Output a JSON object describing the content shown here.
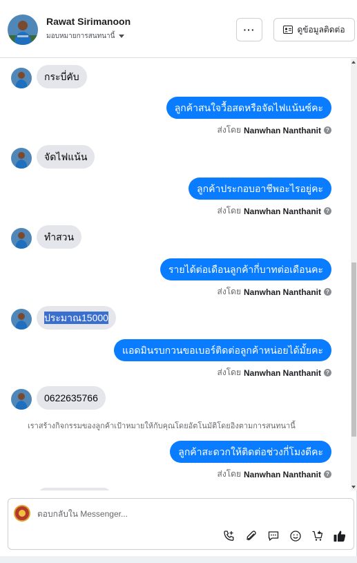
{
  "header": {
    "name": "Rawat Sirimanoon",
    "assign_label": "มอบหมายการสนทนานี้",
    "more_label": "···",
    "info_label": "ดูข้อมูลติดต่อ"
  },
  "messages": [
    {
      "type": "in",
      "text": "กระบี่คับ"
    },
    {
      "type": "out",
      "text": "ลูกค้าสนใจวื้อสดหรือจัดไฟแน้นซ์คะ",
      "sent_by_prefix": "ส่งโดย",
      "sent_by_name": "Nanwhan Nanthanit"
    },
    {
      "type": "in",
      "text": "จัดไฟแน้น"
    },
    {
      "type": "out",
      "text": "ลูกค้าประกอบอาชีพอะไรอยู่คะ",
      "sent_by_prefix": "ส่งโดย",
      "sent_by_name": "Nanwhan Nanthanit"
    },
    {
      "type": "in",
      "text": "ทำสวน"
    },
    {
      "type": "out",
      "text": "รายได้ต่อเดือนลูกค้ากี่บาทต่อเดือนคะ",
      "sent_by_prefix": "ส่งโดย",
      "sent_by_name": "Nanwhan Nanthanit"
    },
    {
      "type": "in",
      "text": "ประมาณ15000",
      "selected": true
    },
    {
      "type": "out",
      "text": "แอดมินรบกวนขอเบอร์ติดต่อลูกค้าหน่อยได้มั้ยคะ",
      "sent_by_prefix": "ส่งโดย",
      "sent_by_name": "Nanwhan Nanthanit"
    },
    {
      "type": "in",
      "text": "0622635766"
    },
    {
      "type": "note",
      "text": "เราสร้างกิจกรรมของลูกค้าเป้าหมายให้กับคุณโดยอัตโนมัติโดยอิงตามการสนทนานี้"
    },
    {
      "type": "out",
      "text": "ลูกค้าสะดวกให้ติดต่อช่วงกี่โมงดีคะ",
      "sent_by_prefix": "ส่งโดย",
      "sent_by_name": "Nanwhan Nanthanit"
    }
  ],
  "composer": {
    "placeholder": "ตอบกลับใน Messenger...",
    "tools": [
      "call-add-icon",
      "attachment-icon",
      "saved-reply-icon",
      "emoji-icon",
      "cart-icon",
      "like-icon"
    ]
  },
  "colors": {
    "outgoing_bubble": "#0a7cff",
    "incoming_bubble": "#e4e6eb",
    "selection": "#3a6fd0"
  }
}
